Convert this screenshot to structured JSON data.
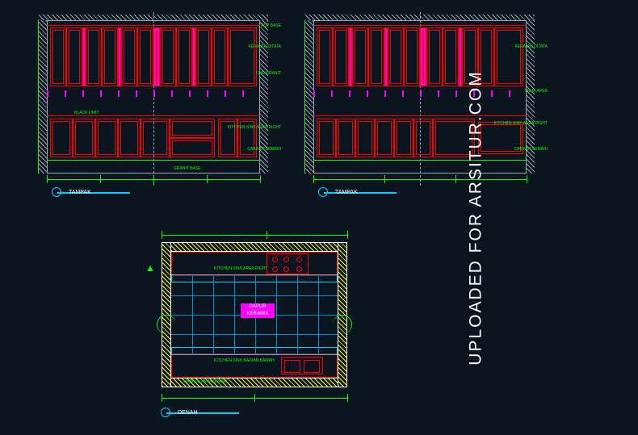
{
  "watermark": "UPLOADED FOR ARSITUR.COM",
  "drawing": {
    "type": "kitchen_cad_drawing",
    "views": [
      "elevation_a",
      "elevation_b",
      "floor_plan"
    ],
    "colors": {
      "cabinet": "#ff0000",
      "accent": "#ff00ff",
      "dimension": "#00ff00",
      "wall_hatch": "#ffff00",
      "detail": "#00cfff",
      "section": "#9ca3af"
    }
  },
  "elev": {
    "upper_cabinets": 12,
    "base_cabinets": 8,
    "labels": {
      "l1": "ACP BASE",
      "l2": "KERAMIK DITATA",
      "l3": "LINE GRANIT",
      "l4": "KITCHEN SINK AREA RIGHT",
      "l5": "CABINET LEMARI",
      "l6": "BLACK LIMIT",
      "l7": "GRANIT BASE",
      "l8": "MEJA AREA"
    },
    "title_a": "TAMPAK",
    "title_b": "TAMPAK"
  },
  "plan": {
    "room_name": "DAPUR",
    "room_sub": "KERAMIK",
    "labels": {
      "p1": "KITCHEN SINK AREA RIGHT",
      "p2": "KITCHEN SINK BAGIAN BAWAH",
      "p3": "MARBLE MEJA GRANIT"
    },
    "title": "DENAH",
    "north": "▲"
  }
}
